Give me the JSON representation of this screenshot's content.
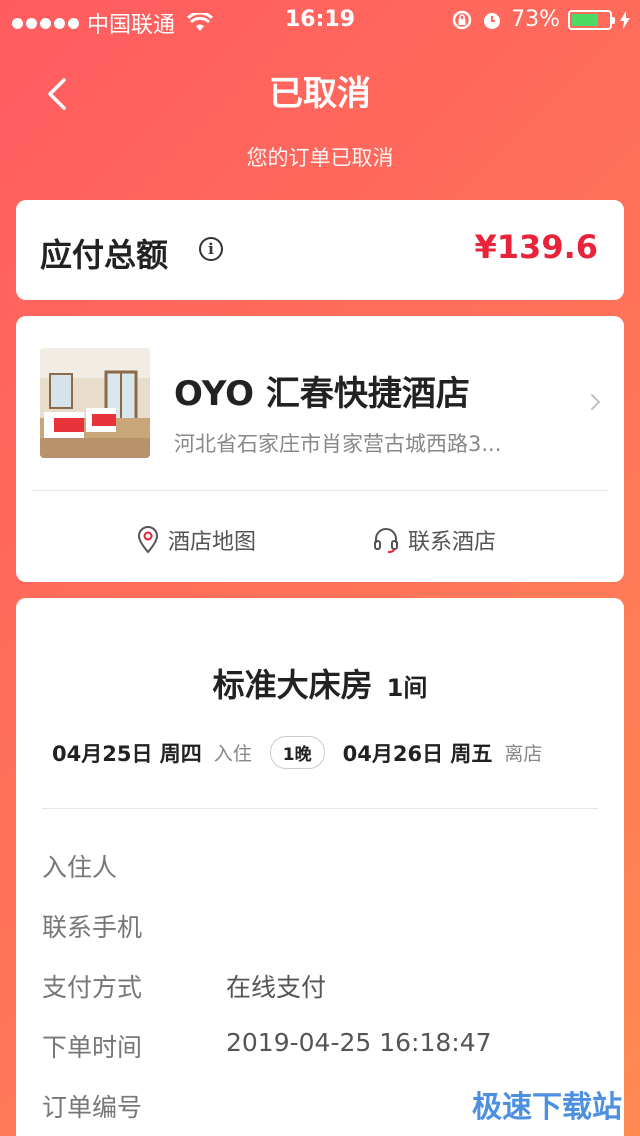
{
  "status_bar": {
    "carrier": "中国联通",
    "time": "16:19",
    "battery": "73%",
    "battery_level": 0.73
  },
  "nav": {
    "title": "已取消",
    "subtitle": "您的订单已取消"
  },
  "payment": {
    "label": "应付总额",
    "info_glyph": "i",
    "amount": "¥139.6"
  },
  "hotel": {
    "name": "OYO 汇春快捷酒店",
    "address": "河北省石家庄市肖家营古城西路3...",
    "actions": {
      "map": "酒店地图",
      "contact": "联系酒店"
    }
  },
  "room": {
    "type": "标准大床房",
    "count": "1间",
    "checkin_date": "04月25日 周四",
    "checkin_label": "入住",
    "nights": "1晚",
    "checkout_date": "04月26日 周五",
    "checkout_label": "离店"
  },
  "order_info": [
    {
      "label": "入住人",
      "value": ""
    },
    {
      "label": "联系手机",
      "value": ""
    },
    {
      "label": "支付方式",
      "value": "在线支付"
    },
    {
      "label": "下单时间",
      "value": "2019-04-25 16:18:47"
    },
    {
      "label": "订单编号",
      "value": ""
    }
  ],
  "watermark": "极速下载站",
  "colors": {
    "accent": "#e8233a",
    "header_gradient_start": "#ff5c60",
    "header_gradient_end": "#ff8a52",
    "battery": "#4cd964"
  }
}
